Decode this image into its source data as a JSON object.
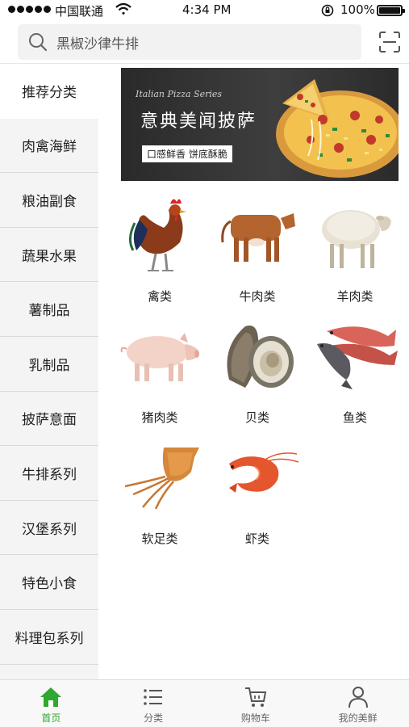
{
  "status_bar": {
    "carrier": "中国联通",
    "time": "4:34 PM",
    "battery": "100%"
  },
  "search": {
    "placeholder": "黑椒沙律牛排"
  },
  "sidebar": {
    "items": [
      {
        "label": "推荐分类",
        "active": true
      },
      {
        "label": "肉禽海鲜"
      },
      {
        "label": "粮油副食"
      },
      {
        "label": "蔬果水果"
      },
      {
        "label": "薯制品"
      },
      {
        "label": "乳制品"
      },
      {
        "label": "披萨意面"
      },
      {
        "label": "牛排系列"
      },
      {
        "label": "汉堡系列"
      },
      {
        "label": "特色小食"
      },
      {
        "label": "料理包系列"
      }
    ]
  },
  "banner": {
    "script_text": "Italian Pizza Series",
    "title": "意典美闻披萨",
    "tag": "口感鲜香 饼底酥脆"
  },
  "categories": [
    {
      "label": "禽类",
      "icon": "chicken-icon"
    },
    {
      "label": "牛肉类",
      "icon": "cow-icon"
    },
    {
      "label": "羊肉类",
      "icon": "sheep-icon"
    },
    {
      "label": "猪肉类",
      "icon": "pig-icon"
    },
    {
      "label": "贝类",
      "icon": "oyster-icon"
    },
    {
      "label": "鱼类",
      "icon": "fish-icon"
    },
    {
      "label": "软足类",
      "icon": "squid-icon"
    },
    {
      "label": "虾类",
      "icon": "shrimp-icon"
    }
  ],
  "tabbar": {
    "home": "首页",
    "category": "分类",
    "cart": "购物车",
    "mine": "我的美鲜"
  },
  "colors": {
    "accent": "#2ea82e"
  }
}
